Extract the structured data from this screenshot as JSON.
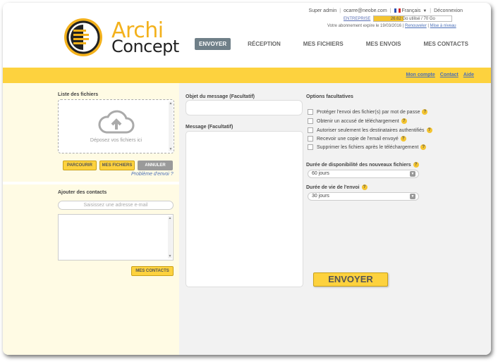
{
  "topbar": {
    "user_role": "Super admin",
    "email": "ocarre@neobe.com",
    "language": "Français",
    "logout": "Déconnexion"
  },
  "quota": {
    "label": "ENTREPRISE",
    "text": "26.62 Go utilisé / 70 Go",
    "used": 26.62,
    "total": 70,
    "expire_text": "Votre abonnement expire le 19/03/2016",
    "renew": "Renouveler",
    "upgrade": "Mise à niveau"
  },
  "logo": {
    "line1": "Archi",
    "line2": "Concept"
  },
  "nav": {
    "items": [
      "ENVOYER",
      "RÉCEPTION",
      "MES FICHIERS",
      "MES ENVOIS",
      "MES CONTACTS"
    ]
  },
  "band": {
    "links": [
      "Mon compte",
      "Contact",
      "Aide"
    ]
  },
  "files": {
    "title": "Liste des fichiers",
    "drop_text": "Déposez vos fichiers ici",
    "browse": "PARCOURIR",
    "my_files": "MES FICHIERS",
    "cancel": "ANNULER",
    "problem": "Problème d'envoi ?"
  },
  "contacts": {
    "title": "Ajouter des contacts",
    "placeholder": "Saisissez une adresse e-mail",
    "my_contacts": "MES CONTACTS"
  },
  "message": {
    "subject_label": "Objet du message (Facultatif)",
    "body_label": "Message (Facultatif)"
  },
  "options": {
    "title": "Options facultatives",
    "items": [
      "Protéger l'envoi des fichier(s) par mot de passe",
      "Obtenir un accusé de téléchargement",
      "Autoriser seulement les destinataires authentifiés",
      "Recevoir une copie de l'email envoyé",
      "Supprimer les fichiers après le téléchargement"
    ],
    "availability_label": "Durée de disponibilité des nouveaux fichiers",
    "availability_value": "60 jours",
    "lifetime_label": "Durée de vie de l'envoi",
    "lifetime_value": "30 jours",
    "send": "ENVOYER"
  },
  "colors": {
    "accent": "#fdd23e",
    "brand": "#f3b11c",
    "nav_active": "#6f7f88",
    "link": "#4a6fb8"
  }
}
